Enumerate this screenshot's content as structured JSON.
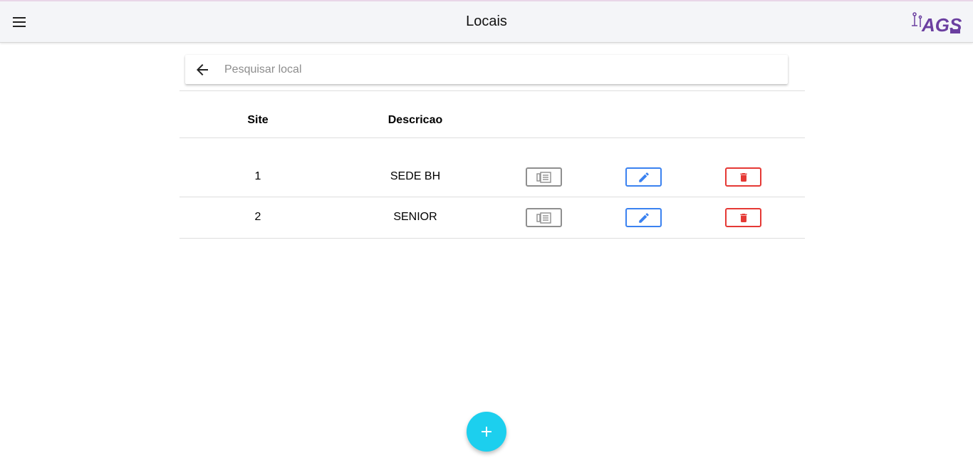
{
  "header": {
    "title": "Locais",
    "menu_icon": "menu-icon",
    "logo_icon": "ags-logo"
  },
  "search": {
    "placeholder": "Pesquisar local",
    "value": "",
    "back_icon": "arrow-back-icon"
  },
  "table": {
    "columns": [
      "Site",
      "Descricao"
    ],
    "rows": [
      {
        "site": "1",
        "descricao": "SEDE BH"
      },
      {
        "site": "2",
        "descricao": "SENIOR"
      }
    ],
    "actions": [
      {
        "name": "view",
        "icon": "list-view-icon"
      },
      {
        "name": "edit",
        "icon": "pencil-icon"
      },
      {
        "name": "delete",
        "icon": "trash-icon"
      }
    ]
  },
  "fab": {
    "icon": "plus-icon"
  },
  "colors": {
    "toolbar_bg": "#f4f5f8",
    "view": "#8f8f8f",
    "edit": "#3b82f0",
    "delete": "#e53935",
    "fab": "#1ccfee",
    "logo": "#6b3fa0"
  }
}
